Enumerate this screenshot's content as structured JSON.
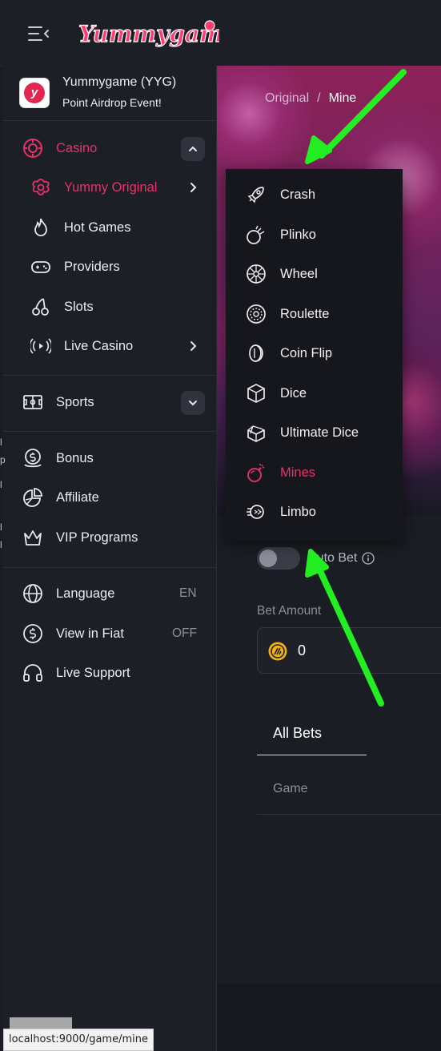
{
  "header": {
    "logo_text": "Yummygame"
  },
  "promo": {
    "title": "Yummygame (YYG)",
    "subtitle": "Point Airdrop Event!"
  },
  "sidebar": {
    "casino": "Casino",
    "yummy_original": "Yummy Original",
    "hot_games": "Hot Games",
    "providers": "Providers",
    "slots": "Slots",
    "live_casino": "Live Casino",
    "sports": "Sports",
    "bonus": "Bonus",
    "affiliate": "Affiliate",
    "vip_programs": "VIP Programs",
    "language": "Language",
    "language_value": "EN",
    "view_in_fiat": "View in Fiat",
    "view_in_fiat_value": "OFF",
    "live_support": "Live Support"
  },
  "breadcrumb": {
    "parent": "Original",
    "separator": "/",
    "current": "Mine"
  },
  "dropdown": {
    "items": [
      "Crash",
      "Plinko",
      "Wheel",
      "Roulette",
      "Coin Flip",
      "Dice",
      "Ultimate Dice",
      "Mines",
      "Limbo"
    ],
    "active": "Mines"
  },
  "game": {
    "auto_bet_label": "Auto Bet",
    "bet_amount_label": "Bet Amount",
    "bet_amount_value": "0",
    "tab_all_bets": "All Bets",
    "column_game": "Game"
  },
  "status_bar": {
    "url": "localhost:9000/game/mine"
  },
  "colors": {
    "accent": "#e8326a",
    "annotation": "#22ee22",
    "sidebar_bg": "#1d1f26",
    "page_bg": "#1b1d24"
  }
}
